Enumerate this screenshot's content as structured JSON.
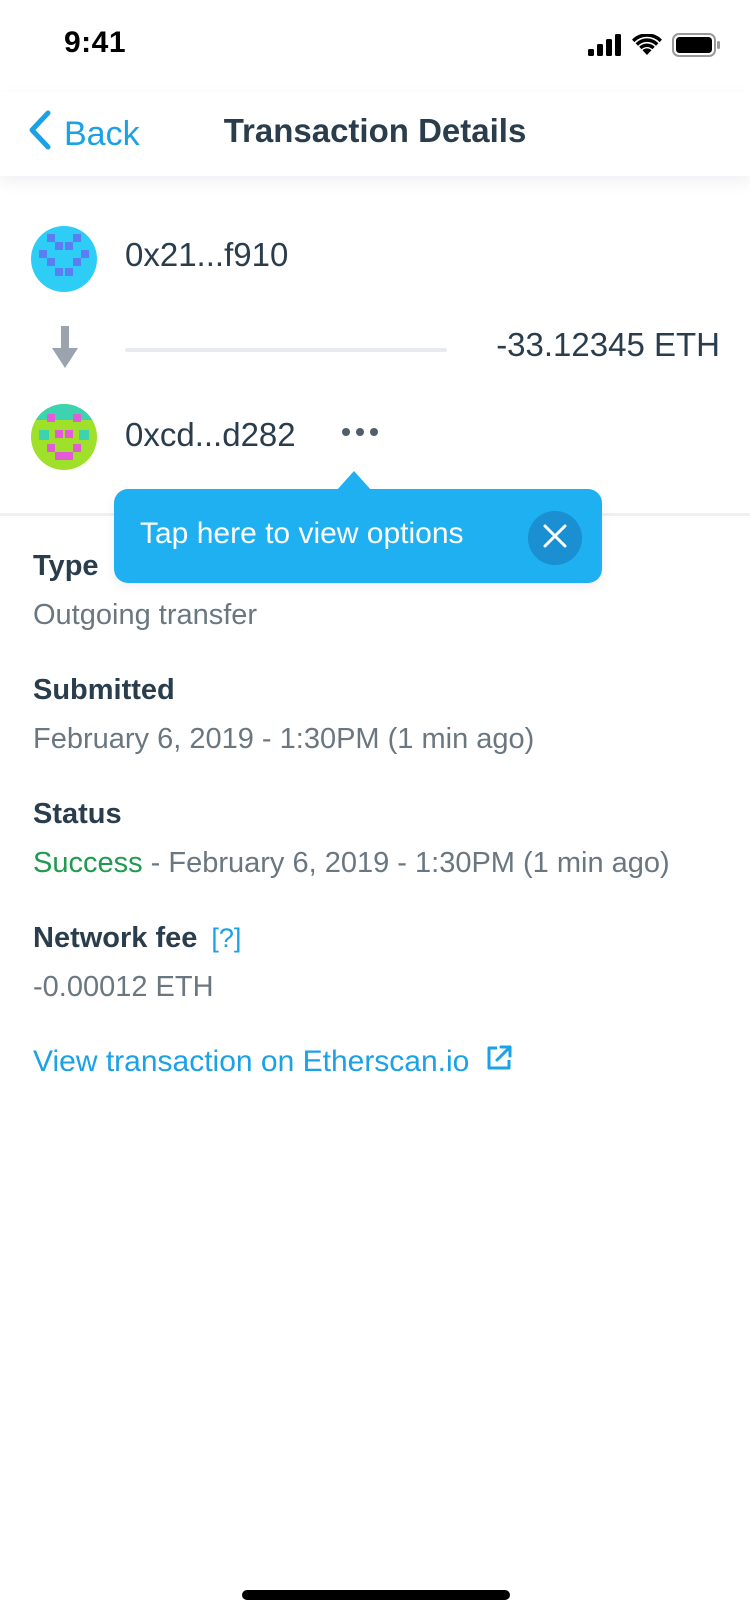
{
  "status_bar": {
    "time": "9:41"
  },
  "nav": {
    "back_label": "Back",
    "title": "Transaction Details"
  },
  "transfer": {
    "from_address": "0x21...f910",
    "to_address": "0xcd...d282",
    "amount": "-33.12345 ETH"
  },
  "tooltip": {
    "text": "Tap here to view options"
  },
  "details": {
    "type_label": "Type",
    "type_value": "Outgoing transfer",
    "submitted_label": "Submitted",
    "submitted_value": "February 6, 2019 - 1:30PM (1 min ago)",
    "status_label": "Status",
    "status_state": "Success",
    "status_rest": " - February 6, 2019 - 1:30PM (1 min ago)",
    "fee_label": "Network fee",
    "fee_help": "[?]",
    "fee_value": "-0.00012 ETH",
    "etherscan_label": "View transaction on Etherscan.io"
  },
  "colors": {
    "accent": "#1aa1e6",
    "tooltip_bg": "#1fb0f2",
    "success": "#1f9a4e",
    "text_primary": "#2a3d4d",
    "text_secondary": "#6b7780"
  },
  "icons": {
    "back": "chevron-left-icon",
    "arrow": "arrow-down-icon",
    "more": "more-horizontal-icon",
    "close": "close-icon",
    "external": "external-link-icon"
  }
}
